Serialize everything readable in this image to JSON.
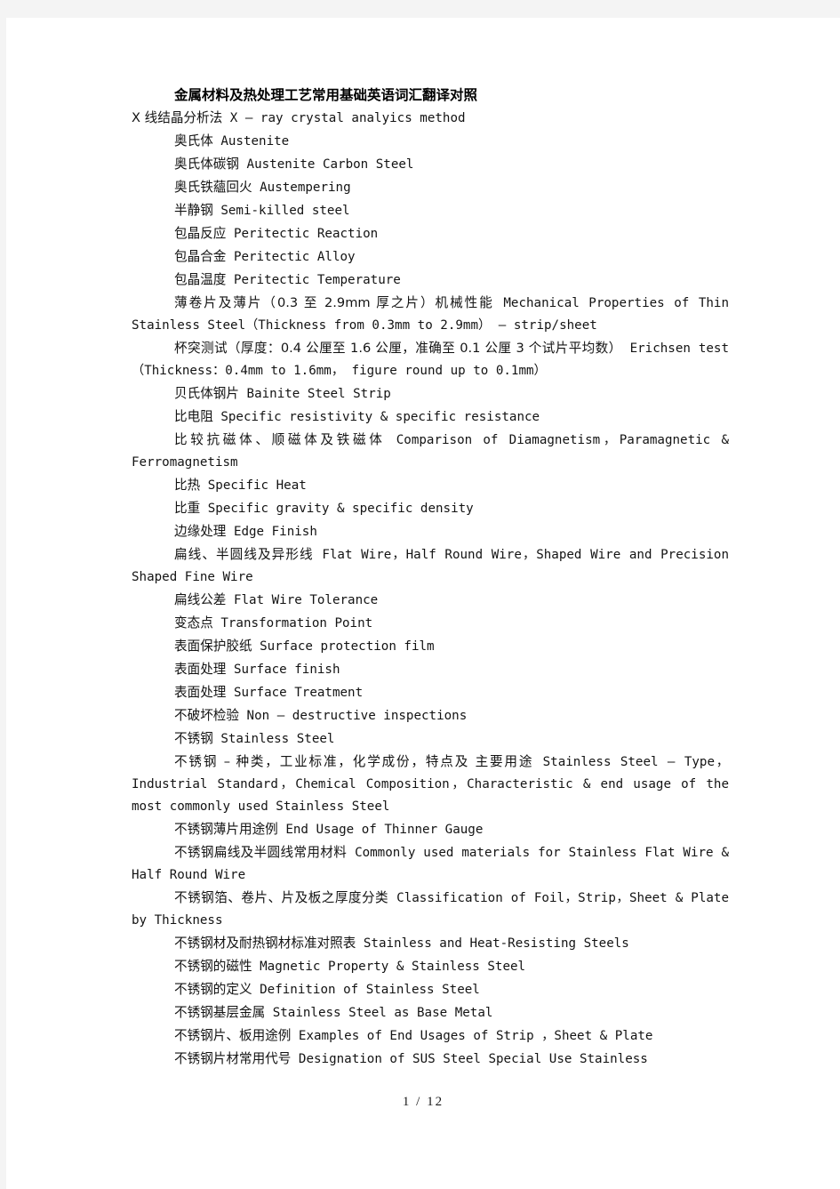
{
  "document": {
    "title": "金属材料及热处理工艺常用基础英语词汇翻译对照",
    "footer": "1 / 12",
    "entries": [
      {
        "indent": false,
        "cjk": "X 线结晶分析法",
        "en": "X – ray crystal analyics method",
        "full": "X 线结晶分析法 X – ray crystal analyics method"
      },
      {
        "indent": true,
        "cjk": "奥氏体",
        "en": "Austenite",
        "full": "奥氏体 Austenite"
      },
      {
        "indent": true,
        "cjk": "奥氏体碳钢",
        "en": "Austenite Carbon Steel",
        "full": "奥氏体碳钢 Austenite Carbon Steel"
      },
      {
        "indent": true,
        "cjk": "奥氏铁蘊回火",
        "en": "Austempering",
        "full": "奥氏铁蘊回火 Austempering"
      },
      {
        "indent": true,
        "cjk": "半静钢",
        "en": "Semi-killed steel",
        "full": "半静钢 Semi-killed steel"
      },
      {
        "indent": true,
        "cjk": "包晶反应",
        "en": "Peritectic Reaction",
        "full": "包晶反应 Peritectic Reaction"
      },
      {
        "indent": true,
        "cjk": "包晶合金",
        "en": "Peritectic Alloy",
        "full": "包晶合金 Peritectic Alloy"
      },
      {
        "indent": true,
        "cjk": "包晶温度",
        "en": "Peritectic Temperature",
        "full": "包晶温度 Peritectic Temperature"
      },
      {
        "indent": true,
        "cjk": "薄卷片及薄片（0.3 至 2.9mm 厚之片）机械性能",
        "en": "Mechanical Properties of Thin Stainless Steel（Thickness from 0.3mm to 2.9mm） – strip/sheet",
        "full": "薄卷片及薄片（0.3 至 2.9mm 厚之片）机械性能 Mechanical Properties of Thin Stainless Steel（Thickness from 0.3mm to 2.9mm） – strip/sheet"
      },
      {
        "indent": true,
        "cjk": "杯突测试（厚度：0.4 公厘至 1.6 公厘，准确至 0.1 公厘 3 个试片平均数）",
        "en": "Erichsen test （Thickness：0.4mm to 1.6mm， figure round up to 0.1mm）",
        "full": "杯突测试（厚度：0.4 公厘至 1.6 公厘，准确至 0.1 公厘 3 个试片平均数）Erichsen test （Thickness：0.4mm to 1.6mm， figure round up to 0.1mm）"
      },
      {
        "indent": true,
        "cjk": "贝氏体钢片",
        "en": "Bainite Steel Strip",
        "full": "贝氏体钢片 Bainite Steel Strip"
      },
      {
        "indent": true,
        "cjk": "比电阻",
        "en": "Specific resistivity & specific resistance",
        "full": "比电阻 Specific resistivity & specific resistance"
      },
      {
        "indent": true,
        "cjk": "比较抗磁体、顺磁体及铁磁体",
        "en": "Comparison of Diamagnetism，Paramagnetic & Ferromagnetism",
        "full": "比较抗磁体、顺磁体及铁磁体 Comparison of Diamagnetism，Paramagnetic & Ferromagnetism"
      },
      {
        "indent": true,
        "cjk": "比热",
        "en": "Specific Heat",
        "full": "比热 Specific Heat"
      },
      {
        "indent": true,
        "cjk": "比重",
        "en": "Specific gravity & specific density",
        "full": "比重 Specific gravity & specific density"
      },
      {
        "indent": true,
        "cjk": "边缘处理",
        "en": "Edge Finish",
        "full": "边缘处理 Edge Finish"
      },
      {
        "indent": true,
        "cjk": "扁线、半圆线及异形线",
        "en": "Flat Wire，Half Round Wire，Shaped Wire and Precision Shaped Fine Wire",
        "full": "扁线、半圆线及异形线 Flat Wire，Half Round Wire，Shaped Wire and Precision Shaped Fine Wire"
      },
      {
        "indent": true,
        "cjk": "扁线公差",
        "en": "Flat Wire Tolerance",
        "full": "扁线公差 Flat Wire Tolerance"
      },
      {
        "indent": true,
        "cjk": "变态点",
        "en": "Transformation Point",
        "full": "变态点 Transformation Point"
      },
      {
        "indent": true,
        "cjk": "表面保护胶纸",
        "en": "Surface protection film",
        "full": "表面保护胶纸 Surface protection film"
      },
      {
        "indent": true,
        "cjk": "表面处理",
        "en": "Surface finish",
        "full": "表面处理 Surface finish"
      },
      {
        "indent": true,
        "cjk": "表面处理",
        "en": "Surface Treatment",
        "full": "表面处理 Surface Treatment"
      },
      {
        "indent": true,
        "cjk": "不破坏检验",
        "en": "Non – destructive inspections",
        "full": "不破坏检验 Non – destructive inspections"
      },
      {
        "indent": true,
        "cjk": "不锈钢",
        "en": "Stainless Steel",
        "full": "不锈钢 Stainless Steel"
      },
      {
        "indent": true,
        "cjk": "不锈钢 – 种类，工业标准，化学成份，特点及 主要用途",
        "en": "Stainless Steel – Type，Industrial Standard，Chemical Composition，Characteristic & end usage of the most commonly used Stainless Steel",
        "full": "不锈钢 – 种类，工业标准，化学成份，特点及 主要用途 Stainless Steel – Type，Industrial Standard，Chemical Composition，Characteristic & end usage of the most commonly used Stainless Steel"
      },
      {
        "indent": true,
        "cjk": "不锈钢薄片用途例",
        "en": "End Usage of Thinner Gauge",
        "full": "不锈钢薄片用途例 End Usage of Thinner Gauge"
      },
      {
        "indent": true,
        "cjk": "不锈钢扁线及半圆线常用材料",
        "en": "Commonly used materials for Stainless Flat Wire & Half Round Wire",
        "full": "不锈钢扁线及半圆线常用材料 Commonly used materials for Stainless Flat Wire & Half Round Wire"
      },
      {
        "indent": true,
        "cjk": "不锈钢箔、卷片、片及板之厚度分类",
        "en": "Classification of Foil，Strip，Sheet & Plate by Thickness",
        "full": "不锈钢箔、卷片、片及板之厚度分类 Classification of Foil，Strip，Sheet & Plate by Thickness"
      },
      {
        "indent": true,
        "cjk": "不锈钢材及耐热钢材标准对照表",
        "en": "Stainless and Heat-Resisting Steels",
        "full": "不锈钢材及耐热钢材标准对照表 Stainless and Heat-Resisting Steels"
      },
      {
        "indent": true,
        "cjk": "不锈钢的磁性",
        "en": "Magnetic Property & Stainless Steel",
        "full": "不锈钢的磁性 Magnetic Property & Stainless Steel"
      },
      {
        "indent": true,
        "cjk": "不锈钢的定义",
        "en": "Definition of Stainless Steel",
        "full": "不锈钢的定义 Definition of Stainless Steel"
      },
      {
        "indent": true,
        "cjk": "不锈钢基层金属",
        "en": "Stainless Steel as Base Metal",
        "full": "不锈钢基层金属 Stainless Steel as Base Metal"
      },
      {
        "indent": true,
        "cjk": "不锈钢片、板用途例",
        "en": "Examples of End Usages of Strip ，Sheet & Plate",
        "full": "不锈钢片、板用途例 Examples of End Usages of Strip ，Sheet & Plate"
      },
      {
        "indent": true,
        "cjk": "不锈钢片材常用代号",
        "en": "Designation of SUS Steel Special Use Stainless",
        "full": "不锈钢片材常用代号 Designation of SUS Steel Special Use Stainless"
      }
    ]
  }
}
